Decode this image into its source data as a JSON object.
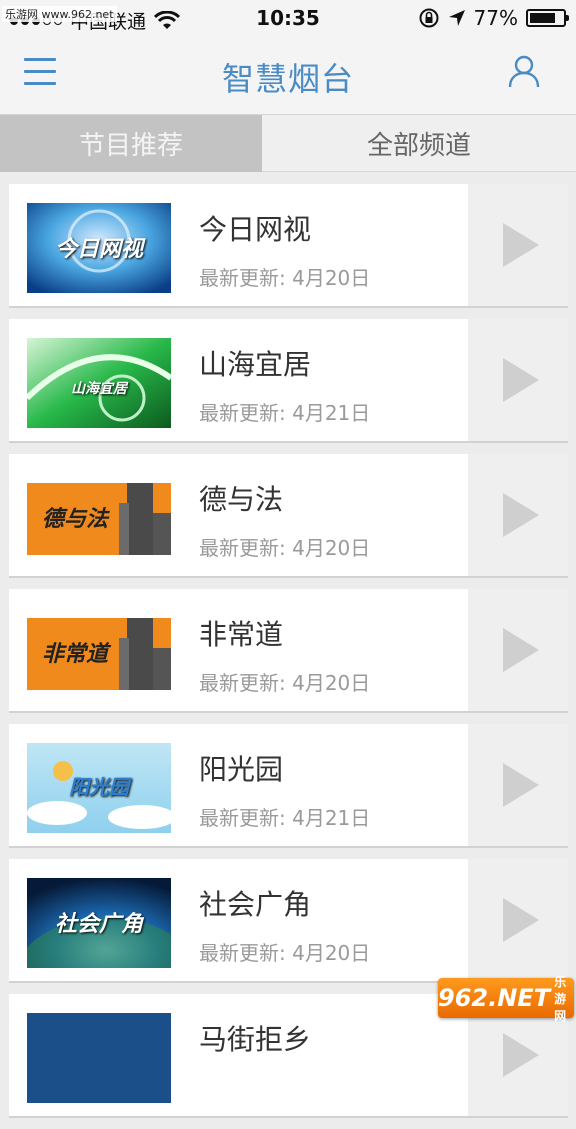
{
  "status_bar": {
    "watermark": "乐游网 www.962.net",
    "carrier": "中国联通",
    "time": "10:35",
    "battery": "77%",
    "battery_level": 0.77,
    "signal_bars_filled": 3,
    "icons": [
      "signal-dots-icon",
      "wifi-icon",
      "rotation-lock-icon",
      "location-arrow-icon",
      "battery-icon"
    ]
  },
  "navbar": {
    "title": "智慧烟台",
    "left_icon": "menu-icon",
    "right_icon": "user-icon",
    "accent": "#4a8bc4"
  },
  "tabs": [
    {
      "label": "节目推荐",
      "active": true
    },
    {
      "label": "全部频道",
      "active": false
    }
  ],
  "programs": [
    {
      "title": "今日网视",
      "date": "最新更新: 4月20日",
      "thumb_text": "今日网视"
    },
    {
      "title": "山海宜居",
      "date": "最新更新: 4月21日",
      "thumb_text": "山海宜居"
    },
    {
      "title": "德与法",
      "date": "最新更新: 4月20日",
      "thumb_text": "德与法"
    },
    {
      "title": "非常道",
      "date": "最新更新: 4月20日",
      "thumb_text": "非常道"
    },
    {
      "title": "阳光园",
      "date": "最新更新: 4月21日",
      "thumb_text": "阳光园"
    },
    {
      "title": "社会广角",
      "date": "最新更新: 4月20日",
      "thumb_text": "社会广角"
    },
    {
      "title": "马街拒乡",
      "date": "",
      "thumb_text": ""
    }
  ],
  "watermark_br": {
    "main": "962.NET",
    "sub": "乐游网"
  }
}
